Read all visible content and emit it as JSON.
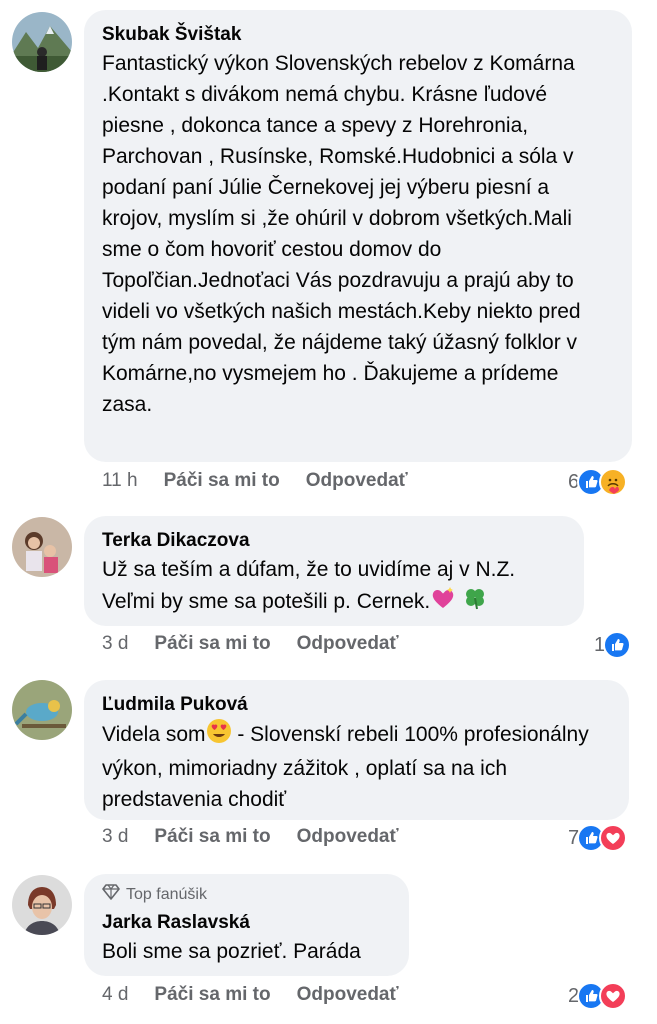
{
  "comments": [
    {
      "author": "Skubak Švištak",
      "text": "Fantastický výkon Slovenských rebelov z Komárna .Kontakt s divákom nemá chybu. Krásne ľudové piesne , dokonca tance a spevy z Horehronia, Parchovan , Rusínske, Romské.Hudobnici a sóla v podaní paní Júlie Černekovej jej výberu piesní a krojov, myslím si ,že ohúril v dobrom všetkých.Mali sme o čom hovoriť cestou domov do Topoľčian.Jednoťaci Vás pozdravuju a prajú aby to videli vo všetkých našich mestách.Keby niekto pred tým nám povedal, že nájdeme taký úžasný folklor v Komárne,no vysmejem ho . Ďakujeme a prídeme zasa.",
      "time": "11 h",
      "like": "Páči sa mi to",
      "reply": "Odpovedať",
      "reaction_count": "6",
      "reactions": [
        "like-icon",
        "care-icon"
      ]
    },
    {
      "author": "Terka Dikaczova",
      "text_line1": "Už sa teším a dúfam, že to uvidíme aj v N.Z.",
      "text_line2": "Veľmi by sme sa potešili p. Cernek.",
      "emojis": [
        "sparkling-heart-icon",
        "four-leaf-clover-icon"
      ],
      "time": "3 d",
      "like": "Páči sa mi to",
      "reply": "Odpovedať",
      "reaction_count": "1",
      "reactions": [
        "like-icon"
      ]
    },
    {
      "author": "Ľudmila Puková",
      "text_before_emoji": "Videla som",
      "text_after_emoji": " - Slovenskí rebeli 100% profesionálny výkon, mimoriadny zážitok , oplatí sa na ich predstavenia chodiť",
      "emoji": "heart-eyes-icon",
      "time": "3 d",
      "like": "Páči sa mi to",
      "reply": "Odpovedať",
      "reaction_count": "7",
      "reactions": [
        "like-icon",
        "love-icon"
      ]
    },
    {
      "badge": "Top fanúšik",
      "author": "Jarka Raslavská",
      "text": "Boli sme sa pozrieť. Paráda",
      "time": "4 d",
      "like": "Páči sa mi to",
      "reply": "Odpovedať",
      "reaction_count": "2",
      "reactions": [
        "like-icon",
        "love-icon"
      ]
    }
  ],
  "colors": {
    "bubble": "#f0f2f5",
    "meta": "#65676b",
    "like_blue": "#1877f2",
    "love_red": "#f33e58"
  }
}
